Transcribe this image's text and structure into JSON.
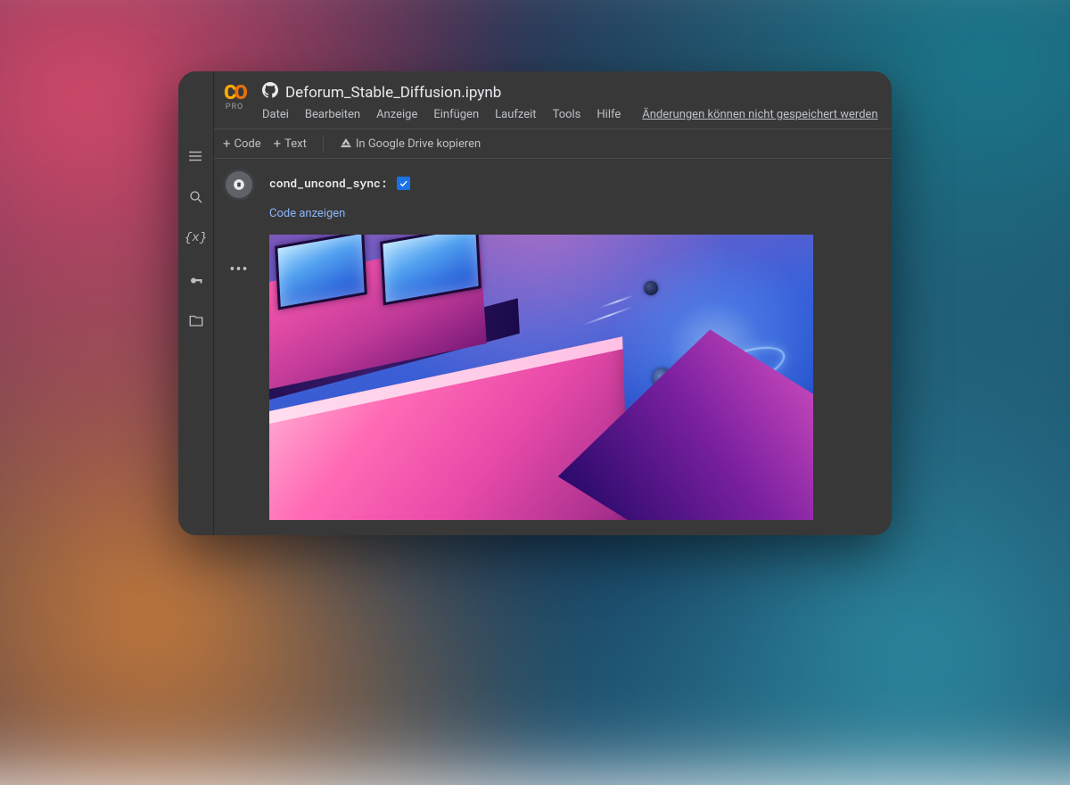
{
  "logo": {
    "pro_label": "PRO"
  },
  "header": {
    "filename": "Deforum_Stable_Diffusion.ipynb"
  },
  "menu": {
    "file": "Datei",
    "edit": "Bearbeiten",
    "view": "Anzeige",
    "insert": "Einfügen",
    "runtime": "Laufzeit",
    "tools": "Tools",
    "help": "Hilfe",
    "save_warning": "Änderungen können nicht gespeichert werden"
  },
  "toolbar": {
    "code": "Code",
    "text": "Text",
    "copy_drive": "In Google Drive kopieren"
  },
  "cell": {
    "param_label": "cond_uncond_sync:",
    "param_checked": true,
    "show_code": "Code anzeigen"
  }
}
